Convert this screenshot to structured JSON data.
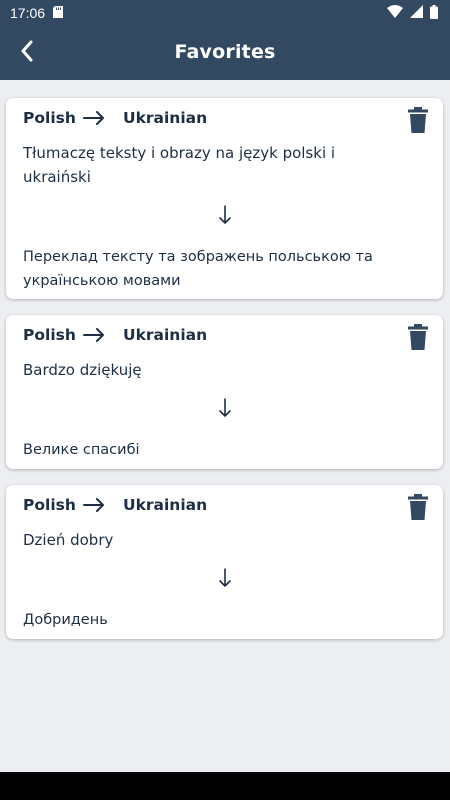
{
  "status_bar": {
    "time": "17:06"
  },
  "app_bar": {
    "title": "Favorites"
  },
  "favorites": [
    {
      "source_lang": "Polish",
      "target_lang": "Ukrainian",
      "source_text": "Tłumaczę teksty i obrazy na język polski i ukraiński",
      "target_text": "Переклад тексту та зображень польською та українською мовами"
    },
    {
      "source_lang": "Polish",
      "target_lang": "Ukrainian",
      "source_text": "Bardzo dziękuję",
      "target_text": "Велике спасибі"
    },
    {
      "source_lang": "Polish",
      "target_lang": "Ukrainian",
      "source_text": "Dzień dobry",
      "target_text": "Добридень"
    }
  ],
  "icons": {
    "back": "back-arrow-icon",
    "delete": "trash-icon",
    "swap": "right-arrow-icon",
    "translate": "down-arrow-icon"
  },
  "colors": {
    "header": "#334962",
    "text": "#1e2f45",
    "background": "#eceef1",
    "card": "#ffffff"
  }
}
